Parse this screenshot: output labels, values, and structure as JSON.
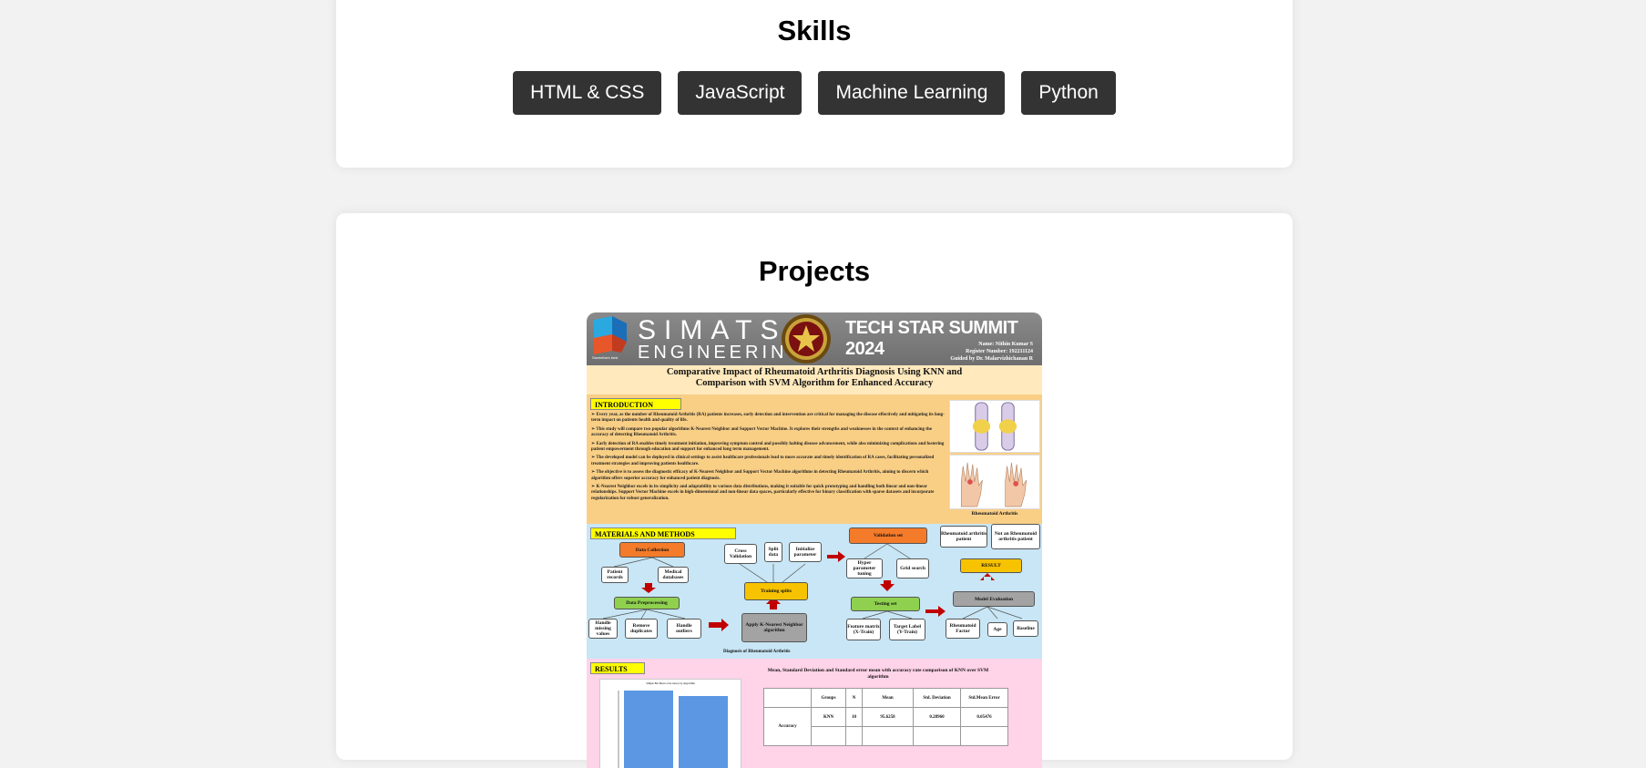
{
  "skills": {
    "title": "Skills",
    "items": [
      {
        "label": "HTML & CSS"
      },
      {
        "label": "JavaScript"
      },
      {
        "label": "Machine Learning"
      },
      {
        "label": "Python"
      }
    ]
  },
  "projects": {
    "title": "Projects",
    "poster": {
      "brand_name": "SIMATS",
      "brand_sub": "ENGINEERING",
      "brand_tag": "Saveetha's best",
      "event": "TECH STAR SUMMIT 2024",
      "name_line": "Name: Nithin Kumar S",
      "register_line": "Register Number: 192211124",
      "guide_line": "Guided by Dr. Malarvizhichanan R",
      "title": "Comparative Impact of Rheumatoid Arthritis Diagnosis Using KNN and Comparison with SVM Algorithm for Enhanced Accuracy",
      "intro_label": "INTRODUCTION",
      "intro_points": [
        "Every year, as the number of Rheumatoid Arthritis (RA) patients increases, early detection and intervention are critical for managing the disease effectively and mitigating its long-term impact on patients health and quality of life.",
        "This study will compare two popular algorithms K-Nearest Neighbor and Support Vector Machine. It explores their strengths and weaknesses in the context of enhancing the accuracy of detecting Rheumatoid Arthritis.",
        "Early detection of RA enables timely treatment initiation, improving symptom control and possibly halting disease advancement, while also minimizing complications and fostering patient empowerment through education and support for enhanced long term management.",
        "The developed model can be deployed in clinical settings to assist healthcare professionals lead to more accurate and timely identification of RA cases, facilitating personalized treatment strategies and improving patients healthcare.",
        "The objective is to assess the diagnostic efficacy of K-Nearest Neighbor and Support Vector Machine algorithms in detecting Rheumatoid Arthritis, aiming to discern which algorithm offers superior accuracy for enhanced patient diagnosis.",
        "K-Nearest Neighbor excels in its simplicity and adaptability to various data distributions, making it suitable for quick prototyping and handling both linear and non-linear relationships. Support Vector Machine excels in high-dimensional and non-linear data spaces, particularly effective for binary classification with sparse datasets and incorporate regularization for robust generalization."
      ],
      "figure_caption": "Rheumatoid Arthritis",
      "methods_label": "MATERIALS AND METHODS",
      "nodes": {
        "data_collection": "Data Collection",
        "patient_records": "Patient records",
        "medical_databases": "Medical databases",
        "data_preprocessing": "Data Preprocessing",
        "handle_missing": "Handle missing values",
        "remove_duplicates": "Remove duplicates",
        "handle_outliers": "Handle outliers",
        "cross_validation": "Cross Validation",
        "split_data": "Split data",
        "initialize_parameter": "Initialize parameter",
        "training_splits": "Training splits",
        "apply_knn": "Apply K-Nearest Neighbor algorithm",
        "validation_set": "Validation set",
        "hyper_param": "Hyper parameter tuning",
        "grid_search": "Grid search",
        "testing_set": "Testing set",
        "feature_matrix": "Feature matrix (X-Train)",
        "target_label": "Target Label (Y-Train)",
        "ra_patient": "Rheumatoid arthritis patient",
        "not_ra_patient": "Not an Rheumatoid arthritis patient",
        "result": "RESULT",
        "model_evaluation": "Model Evaluation",
        "rheumatoid_factor": "Rheumatoid Factor",
        "age": "Age",
        "baseline": "Baseline"
      },
      "methods_caption": "Diagnosis of Rheumatoid Arthritis",
      "results_label": "RESULTS",
      "table_caption": "Mean, Standard Deviation and Standard error mean with accuracy rate comparison of KNN over SVM algorithm",
      "table_headers": [
        "Groups",
        "N",
        "Mean",
        "Std. Deviation",
        "Std.Mean Error"
      ],
      "table_row_label": "Accuracy",
      "table_row": [
        "KNN",
        "10",
        "95.6258",
        "0.28960",
        "0.05476"
      ],
      "chart_title": "Simple Bar Mean of Accuracy by Algorithm"
    }
  },
  "colors": {
    "page_bg": "#f2f2f2",
    "card_bg": "#ffffff",
    "badge_bg": "#333333",
    "badge_text": "#ffffff"
  }
}
